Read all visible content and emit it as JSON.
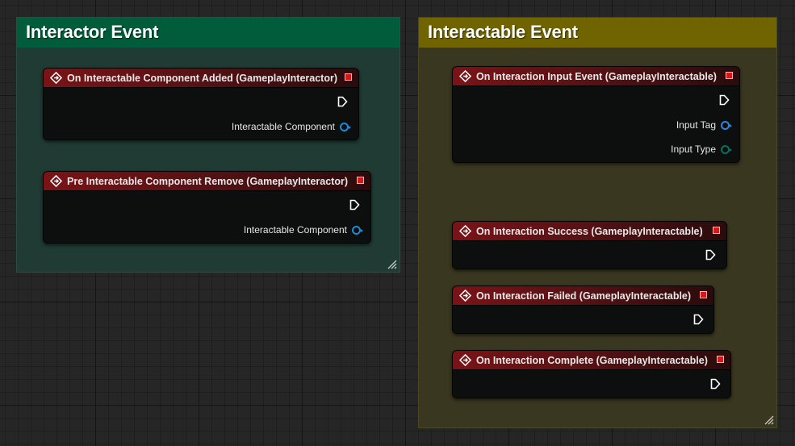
{
  "comments": {
    "interactor": {
      "title": "Interactor Event",
      "color": "#005c3a"
    },
    "interactable": {
      "title": "Interactable Event",
      "color": "#6f6400"
    }
  },
  "nodes": {
    "added": {
      "title": "On Interactable Component Added (GameplayInteractor)",
      "pins": [
        "Interactable Component"
      ]
    },
    "remove": {
      "title": "Pre Interactable Component Remove (GameplayInteractor)",
      "pins": [
        "Interactable Component"
      ]
    },
    "input": {
      "title": "On Interaction Input Event (GameplayInteractable)",
      "pins": [
        "Input Tag",
        "Input Type"
      ]
    },
    "success": {
      "title": "On Interaction Success (GameplayInteractable)"
    },
    "failed": {
      "title": "On Interaction Failed (GameplayInteractable)"
    },
    "complete": {
      "title": "On Interaction Complete (GameplayInteractable)"
    }
  },
  "colors": {
    "object_pin": "#1e8ad6",
    "gameplay_tag_pin": "#3b7fd1",
    "enum_pin": "#0f6b5c",
    "event_header": "#7a1316"
  },
  "icons": {
    "event": "event-diamond-icon",
    "exec": "exec-output-icon",
    "close": "breakpoint-square-icon",
    "resize": "resize-grip-icon"
  }
}
